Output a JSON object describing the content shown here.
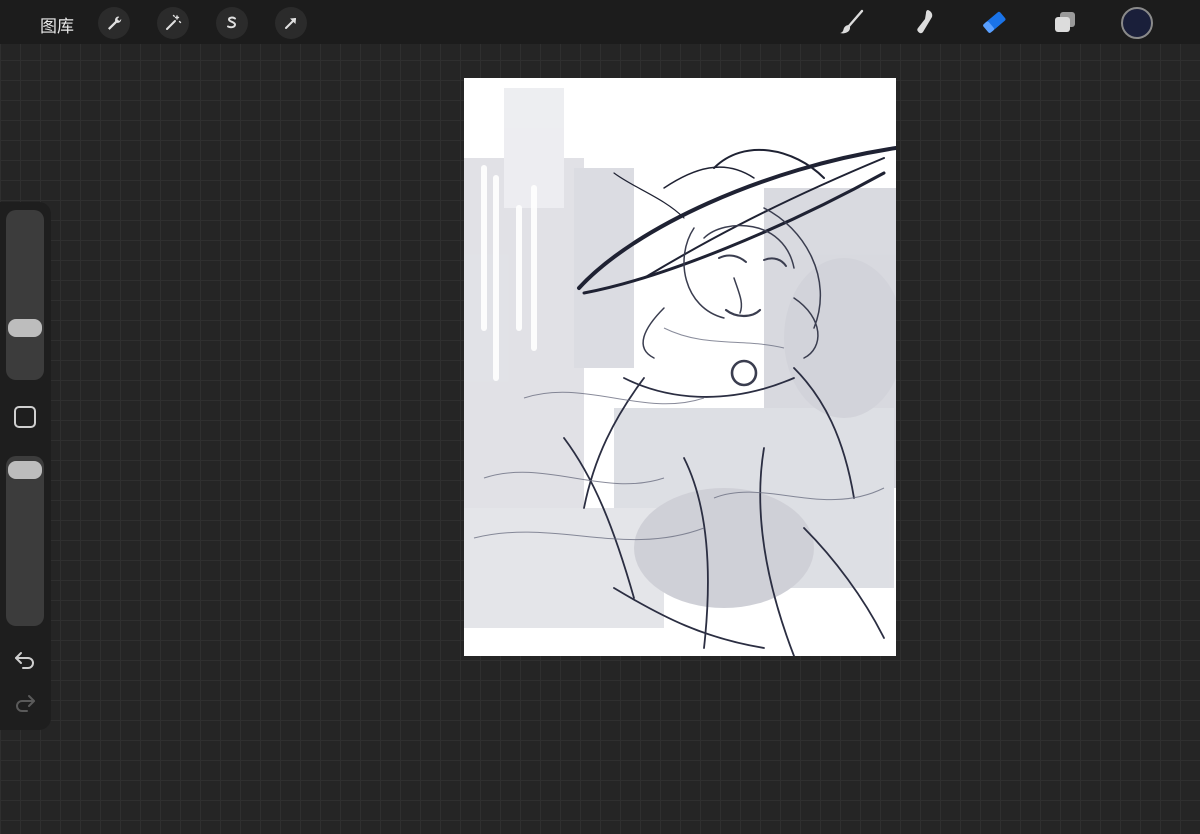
{
  "topbar": {
    "gallery_label": "图库",
    "left_tools": [
      "wrench-icon",
      "magic-wand-icon",
      "selection-icon",
      "transform-arrow-icon"
    ],
    "right_tools": [
      "brush-icon",
      "smudge-icon",
      "eraser-icon",
      "layers-icon"
    ],
    "active_tool": "eraser",
    "accent_color": "#1a73e8",
    "current_color": "#1a1f3a"
  },
  "sidebar": {
    "brush_size_level": 0.15,
    "opacity_level": 0.02,
    "controls": [
      "brush-size-slider",
      "modify-square-icon",
      "opacity-slider",
      "undo-icon",
      "redo-icon"
    ]
  },
  "canvas": {
    "content": "sketch-artwork"
  }
}
